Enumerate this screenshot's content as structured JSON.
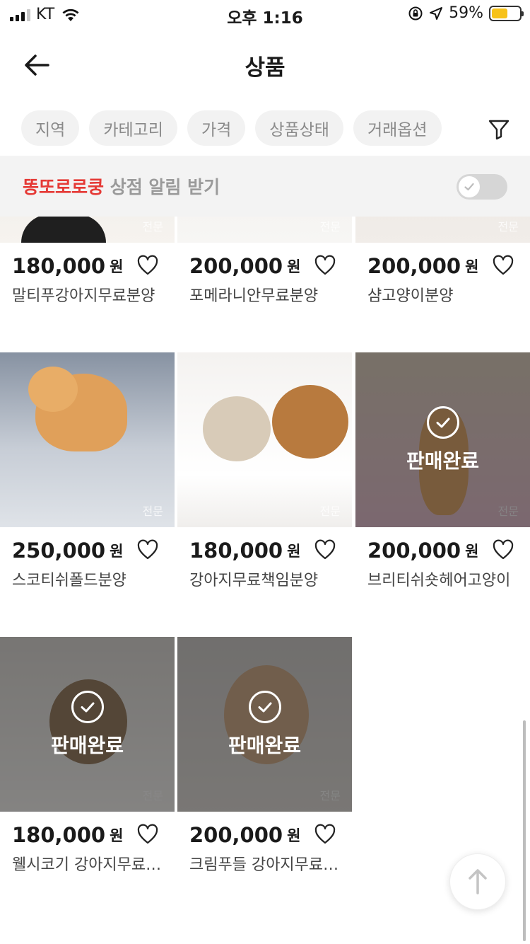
{
  "status_bar": {
    "carrier": "KT",
    "time": "오후 1:16",
    "battery_percent": "59%",
    "battery_level": 0.59,
    "battery_color": "#f7c21a"
  },
  "header": {
    "title": "상품"
  },
  "filters": {
    "chips": [
      "지역",
      "카테고리",
      "가격",
      "상품상태",
      "거래옵션"
    ]
  },
  "notify": {
    "shop_name": "똥또로로쿵",
    "text": " 상점 알림 받기",
    "toggle_on": false,
    "shop_color": "#e53935"
  },
  "products": [
    {
      "price": "180,000",
      "unit": "원",
      "name": "말티푸강아지무료분양",
      "sold": false,
      "watermark": "전문"
    },
    {
      "price": "200,000",
      "unit": "원",
      "name": "포메라니안무료분양",
      "sold": false,
      "watermark": "전문"
    },
    {
      "price": "200,000",
      "unit": "원",
      "name": "샴고양이분양",
      "sold": false,
      "watermark": "전문"
    },
    {
      "price": "250,000",
      "unit": "원",
      "name": "스코티쉬폴드분양",
      "sold": false,
      "watermark": "전문"
    },
    {
      "price": "180,000",
      "unit": "원",
      "name": "강아지무료책임분양",
      "sold": false,
      "watermark": "전문"
    },
    {
      "price": "200,000",
      "unit": "원",
      "name": "브리티쉬숏헤어고양이",
      "sold": true,
      "sold_label": "판매완료",
      "watermark": "전문"
    },
    {
      "price": "180,000",
      "unit": "원",
      "name": "웰시코기 강아지무료분양",
      "sold": true,
      "sold_label": "판매완료",
      "watermark": "전문"
    },
    {
      "price": "200,000",
      "unit": "원",
      "name": "크림푸들 강아지무료분양",
      "sold": true,
      "sold_label": "판매완료",
      "watermark": "전문"
    }
  ],
  "icons": {
    "back": "arrow-left-icon",
    "filter": "funnel-icon",
    "heart": "heart-outline-icon",
    "sold": "check-circle-icon",
    "top": "arrow-up-icon"
  }
}
